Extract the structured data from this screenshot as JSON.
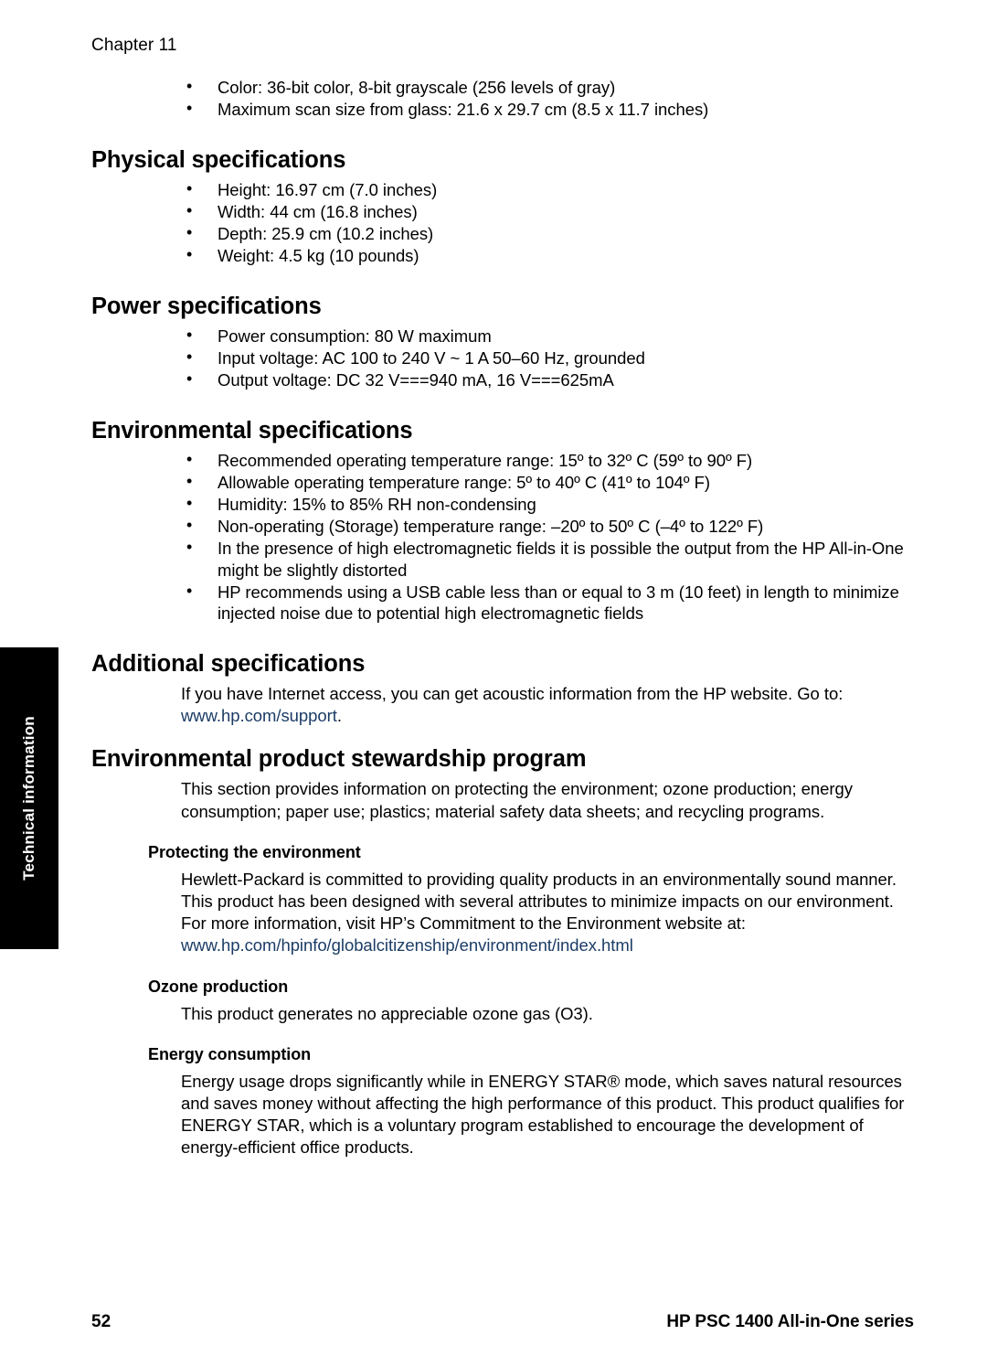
{
  "header": {
    "chapter": "Chapter 11"
  },
  "side_tab": {
    "label": "Technical information"
  },
  "intro_bullets": [
    "Color: 36-bit color, 8-bit grayscale (256 levels of gray)",
    "Maximum scan size from glass: 21.6 x 29.7 cm (8.5 x 11.7 inches)"
  ],
  "sections": {
    "physical": {
      "heading": "Physical specifications",
      "bullets": [
        "Height: 16.97 cm (7.0 inches)",
        "Width: 44 cm (16.8 inches)",
        "Depth: 25.9 cm (10.2 inches)",
        "Weight: 4.5 kg (10 pounds)"
      ]
    },
    "power": {
      "heading": "Power specifications",
      "bullets": [
        "Power consumption: 80 W maximum",
        "Input voltage: AC 100 to 240 V ~ 1 A 50–60 Hz, grounded",
        "Output voltage: DC 32 V===940 mA, 16 V===625mA"
      ]
    },
    "environmental": {
      "heading": "Environmental specifications",
      "bullets": [
        "Recommended operating temperature range: 15º to 32º C (59º to 90º F)",
        "Allowable operating temperature range: 5º to 40º C (41º to 104º F)",
        "Humidity: 15% to 85% RH non-condensing",
        "Non-operating (Storage) temperature range: –20º to 50º C (–4º to 122º F)",
        "In the presence of high electromagnetic fields it is possible the output from the HP All-in-One might be slightly distorted",
        "HP recommends using a USB cable less than or equal to 3 m (10 feet) in length to minimize injected noise due to potential high electromagnetic fields"
      ]
    },
    "additional": {
      "heading": "Additional specifications",
      "paragraph_before_link": "If you have Internet access, you can get acoustic information from the HP website. Go to:",
      "link_text": "www.hp.com/support",
      "link_trailing": "."
    },
    "stewardship": {
      "heading": "Environmental product stewardship program",
      "paragraph": "This section provides information on protecting the environment; ozone production; energy consumption; paper use; plastics; material safety data sheets; and recycling programs.",
      "subsections": {
        "protecting": {
          "heading": "Protecting the environment",
          "paragraph": "Hewlett-Packard is committed to providing quality products in an environmentally sound manner. This product has been designed with several attributes to minimize impacts on our environment. For more information, visit HP’s Commitment to the Environment website at:",
          "link_text": "www.hp.com/hpinfo/globalcitizenship/environment/index.html"
        },
        "ozone": {
          "heading": "Ozone production",
          "paragraph": "This product generates no appreciable ozone gas (O3)."
        },
        "energy": {
          "heading": "Energy consumption",
          "paragraph": "Energy usage drops significantly while in ENERGY STAR® mode, which saves natural resources and saves money without affecting the high performance of this product. This product qualifies for ENERGY STAR, which is a voluntary program established to encourage the development of energy-efficient office products."
        }
      }
    }
  },
  "footer": {
    "page_number": "52",
    "product": "HP PSC 1400 All-in-One series"
  },
  "colors": {
    "link": "#1b3c66",
    "tab_background": "#000000",
    "tab_text": "#ffffff",
    "body_text": "#000000"
  }
}
